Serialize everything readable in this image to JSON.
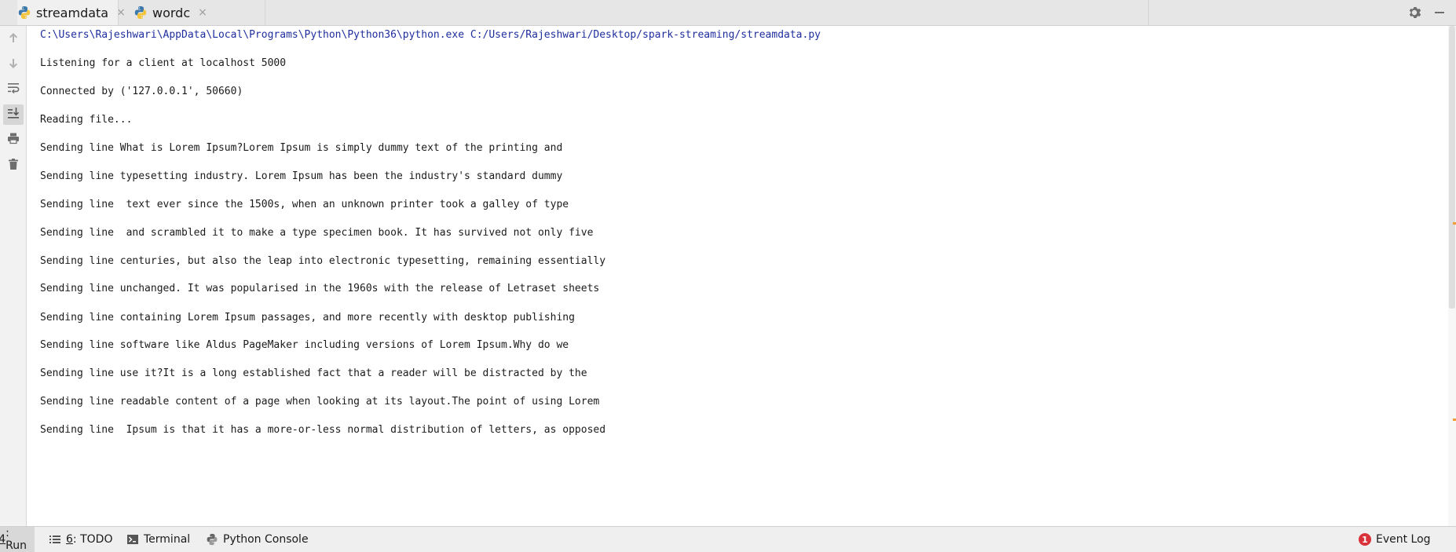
{
  "tabs": [
    {
      "label": "streamdata",
      "icon": "python-file-icon",
      "active": true
    },
    {
      "label": "wordc",
      "icon": "python-file-icon",
      "active": false
    }
  ],
  "tab_close_glyph": "×",
  "tools": {
    "settings_icon": "gear-icon",
    "minimize_icon": "minimize-icon"
  },
  "left_toolbar": [
    {
      "icon": "arrow-up-icon"
    },
    {
      "icon": "arrow-down-icon"
    },
    {
      "icon": "soft-wrap-icon"
    },
    {
      "icon": "scroll-to-end-icon"
    },
    {
      "icon": "print-icon"
    },
    {
      "icon": "trash-icon"
    }
  ],
  "console": {
    "command": "C:\\Users\\Rajeshwari\\AppData\\Local\\Programs\\Python\\Python36\\python.exe C:/Users/Rajeshwari/Desktop/spark-streaming/streamdata.py",
    "lines": [
      "Listening for a client at localhost 5000",
      "Connected by ('127.0.0.1', 50660)",
      "Reading file...",
      "Sending line What is Lorem Ipsum?Lorem Ipsum is simply dummy text of the printing and",
      "Sending line typesetting industry. Lorem Ipsum has been the industry's standard dummy",
      "Sending line  text ever since the 1500s, when an unknown printer took a galley of type",
      "Sending line  and scrambled it to make a type specimen book. It has survived not only five",
      "Sending line centuries, but also the leap into electronic typesetting, remaining essentially",
      "Sending line unchanged. It was popularised in the 1960s with the release of Letraset sheets",
      "Sending line containing Lorem Ipsum passages, and more recently with desktop publishing",
      "Sending line software like Aldus PageMaker including versions of Lorem Ipsum.Why do we",
      "Sending line use it?It is a long established fact that a reader will be distracted by the",
      "Sending line readable content of a page when looking at its layout.The point of using Lorem",
      "Sending line  Ipsum is that it has a more-or-less normal distribution of letters, as opposed"
    ]
  },
  "statusbar": {
    "run": {
      "prefix": "4",
      "label": ": Run"
    },
    "todo": {
      "prefix": "6",
      "label": ": TODO"
    },
    "terminal": {
      "label": "Terminal"
    },
    "python_console": {
      "label": "Python Console"
    },
    "event_log": {
      "badge": "1",
      "label": "Event Log"
    }
  },
  "colors": {
    "command_text": "#1f2e9e",
    "output_text": "#1b1b1b",
    "error_badge": "#d9323a",
    "scroll_marker": "#f29c38"
  }
}
